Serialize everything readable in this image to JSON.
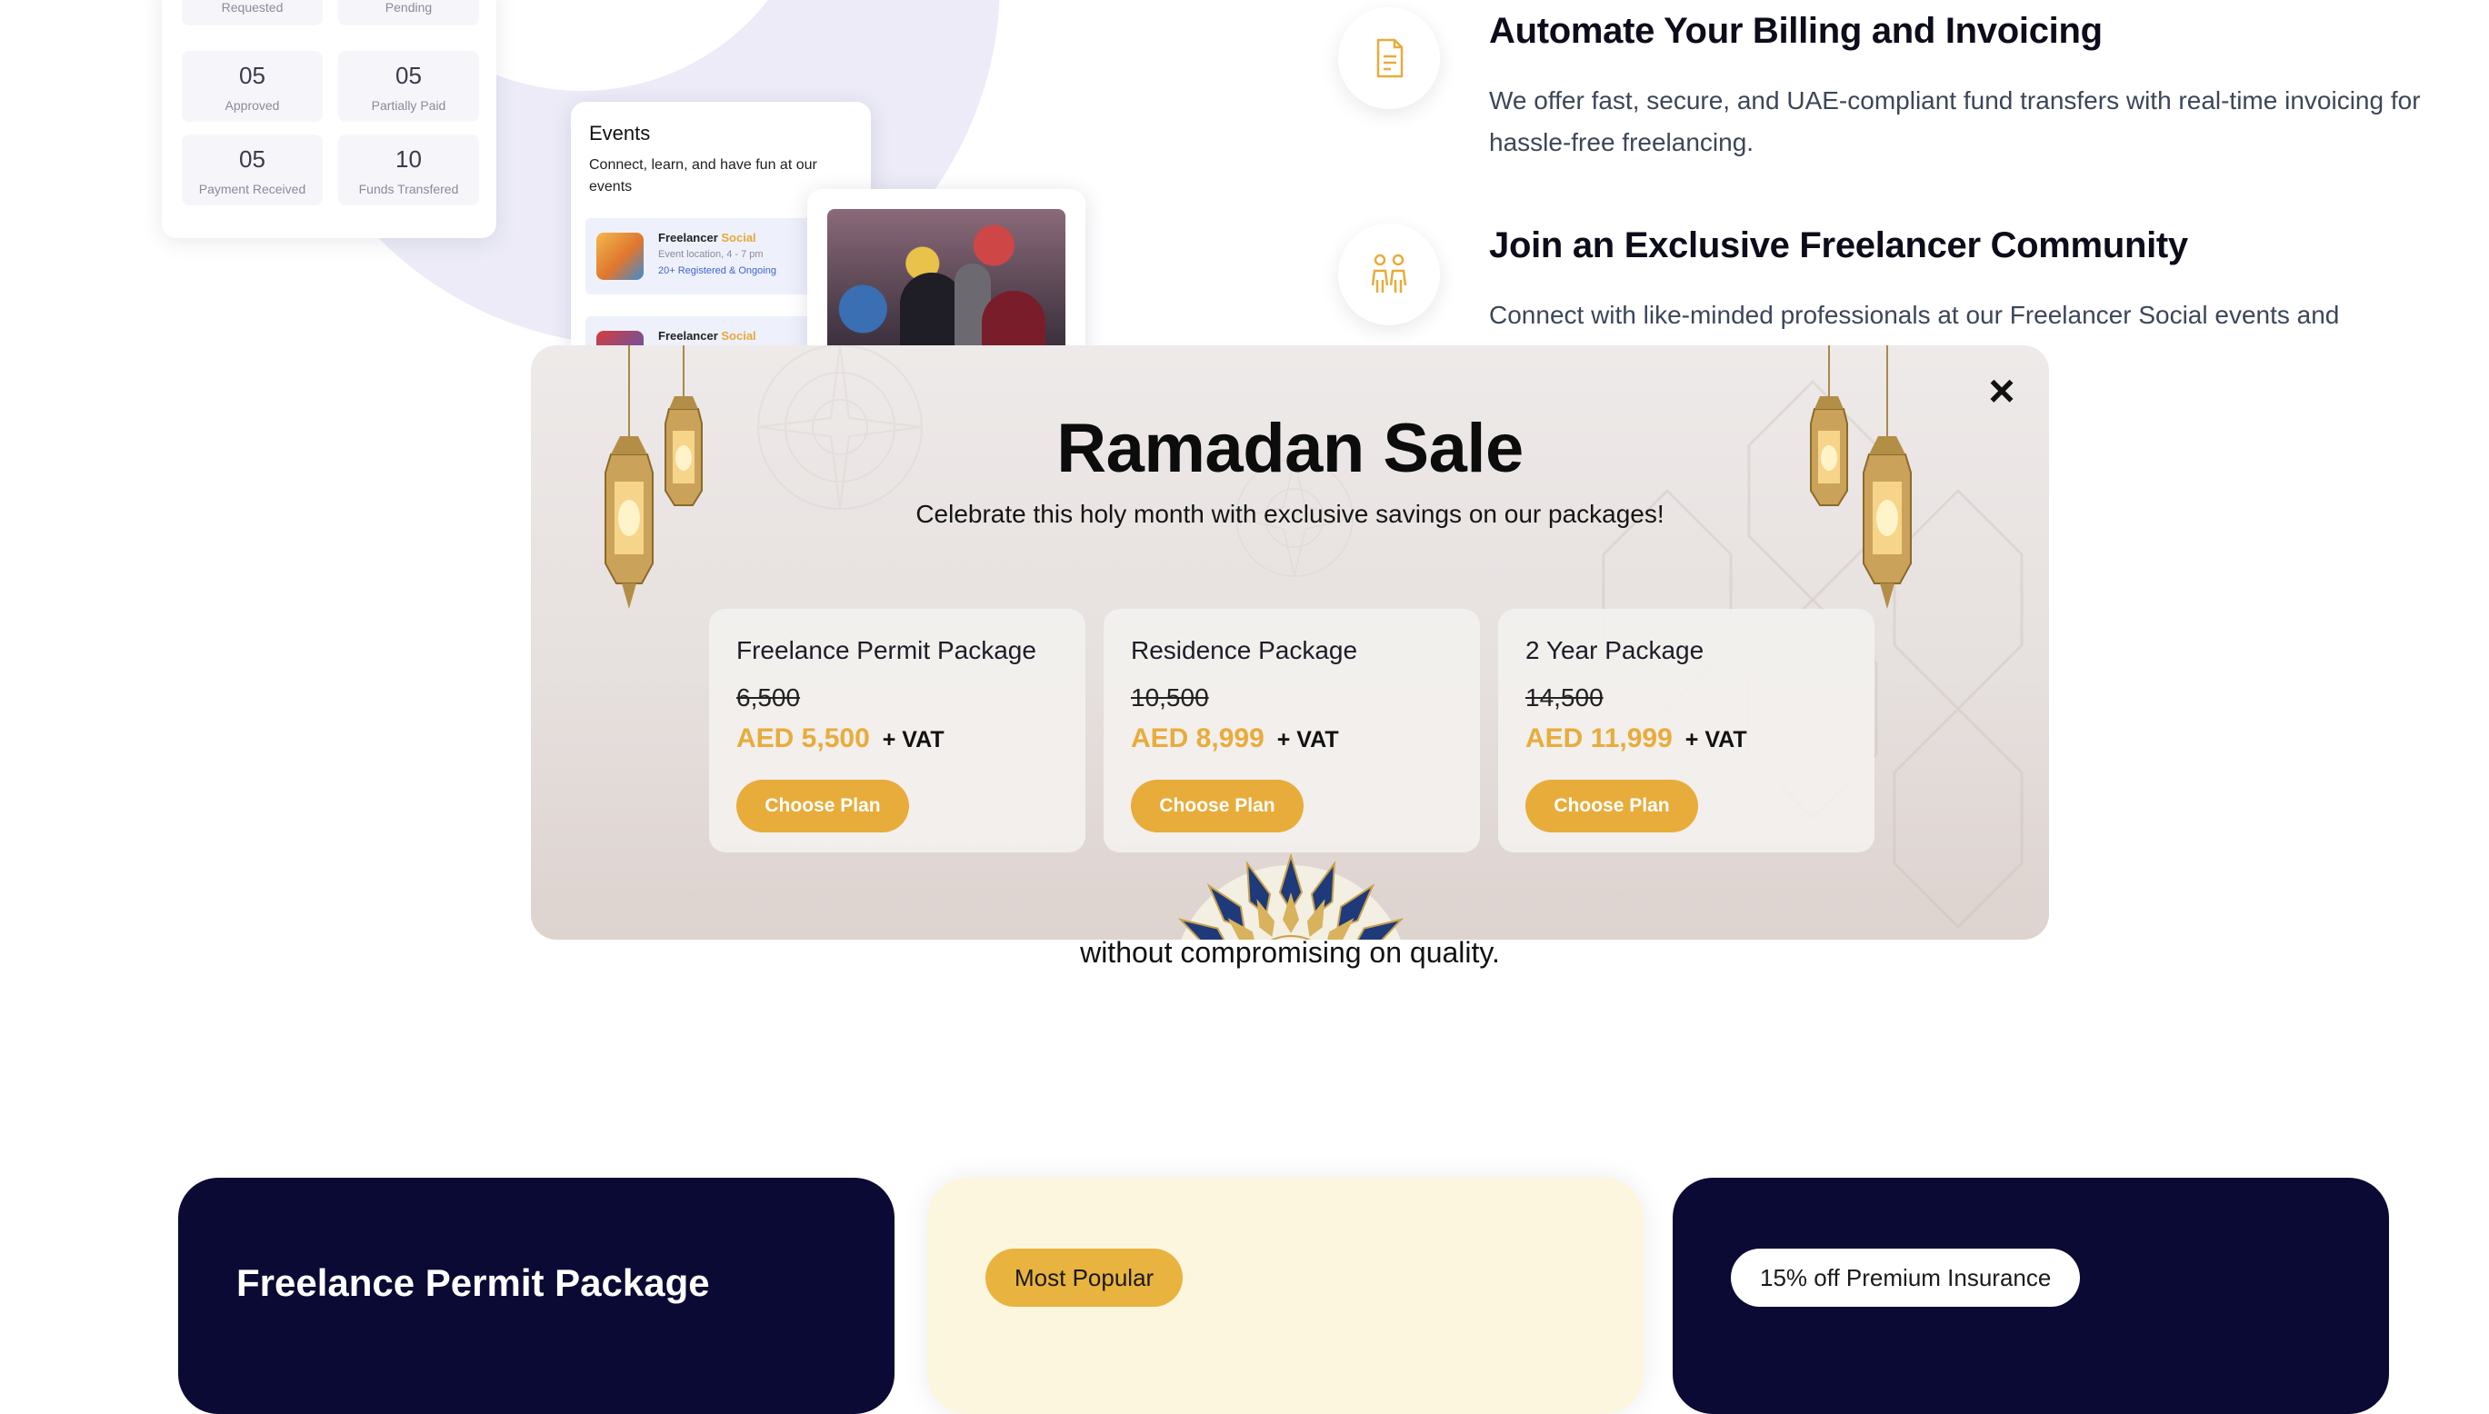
{
  "stats": [
    {
      "value": "",
      "label": "Requested"
    },
    {
      "value": "",
      "label": "Pending"
    },
    {
      "value": "05",
      "label": "Approved"
    },
    {
      "value": "05",
      "label": "Partially Paid"
    },
    {
      "value": "05",
      "label": "Payment Received"
    },
    {
      "value": "10",
      "label": "Funds Transfered"
    }
  ],
  "events": {
    "title": "Events",
    "subtitle": "Connect, learn, and have fun at our events",
    "items": [
      {
        "name_main": "Freelancer ",
        "name_accent": "Social",
        "location": "Event location, 4 - 7 pm",
        "registered": "20+ Registered & Ongoing"
      },
      {
        "name_main": "Freelancer ",
        "name_accent": "Social"
      }
    ]
  },
  "features": [
    {
      "icon": "invoice-icon",
      "title": "Automate Your Billing and Invoicing",
      "desc": "We offer fast, secure, and UAE-compliant fund transfers with real-time invoicing for hassle-free freelancing."
    },
    {
      "icon": "community-icon",
      "title": "Join an Exclusive Freelancer Community",
      "desc": "Connect with like-minded professionals at our Freelancer Social events and"
    }
  ],
  "below_text": "without compromising on quality.",
  "plans_section": {
    "left_name": "Freelance Permit Package",
    "middle_pill": "Most Popular",
    "right_pill": "15% off Premium Insurance"
  },
  "modal": {
    "close_label": "×",
    "title": "Ramadan Sale",
    "subtitle": "Celebrate this holy month with exclusive savings on our packages!",
    "packages": [
      {
        "name": "Freelance Permit Package",
        "old_price": "6,500",
        "price": "AED 5,500",
        "vat": "+ VAT",
        "cta": "Choose Plan"
      },
      {
        "name": "Residence Package",
        "old_price": "10,500",
        "price": "AED 8,999",
        "vat": "+ VAT",
        "cta": "Choose Plan"
      },
      {
        "name": "2 Year Package",
        "old_price": "14,500",
        "price": "AED 11,999",
        "vat": "+ VAT",
        "cta": "Choose Plan"
      }
    ]
  },
  "colors": {
    "accent_gold": "#e8ac3b",
    "navy": "#0a0a34",
    "cream": "#fdf6df"
  }
}
